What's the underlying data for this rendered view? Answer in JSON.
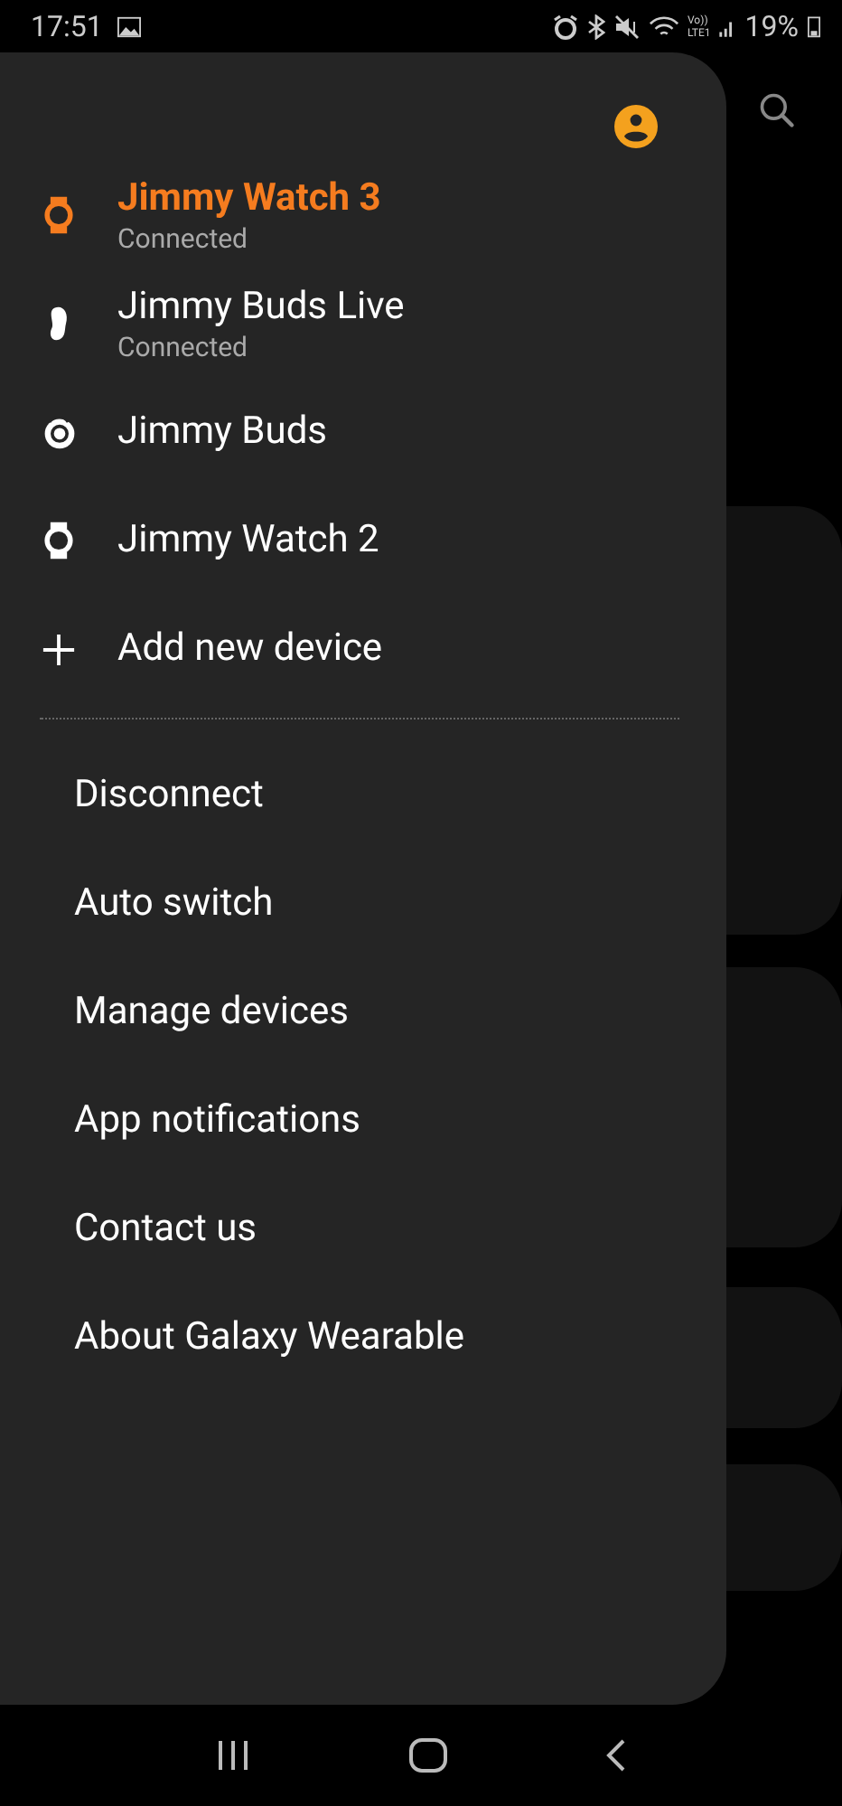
{
  "status_bar": {
    "time": "17:51",
    "volte": "Vo))",
    "lte": "LTE1",
    "battery": "19%"
  },
  "drawer": {
    "devices": [
      {
        "kind": "watch",
        "name": "Jimmy Watch 3",
        "status": "Connected",
        "selected": true
      },
      {
        "kind": "buds-live",
        "name": "Jimmy Buds Live",
        "status": "Connected",
        "selected": false
      },
      {
        "kind": "buds",
        "name": "Jimmy Buds",
        "selected": false
      },
      {
        "kind": "watch",
        "name": "Jimmy Watch 2",
        "selected": false
      },
      {
        "kind": "add",
        "name": "Add new device",
        "selected": false
      }
    ],
    "menu": [
      "Disconnect",
      "Auto switch",
      "Manage devices",
      "App notifications",
      "Contact us",
      "About Galaxy Wearable"
    ]
  }
}
